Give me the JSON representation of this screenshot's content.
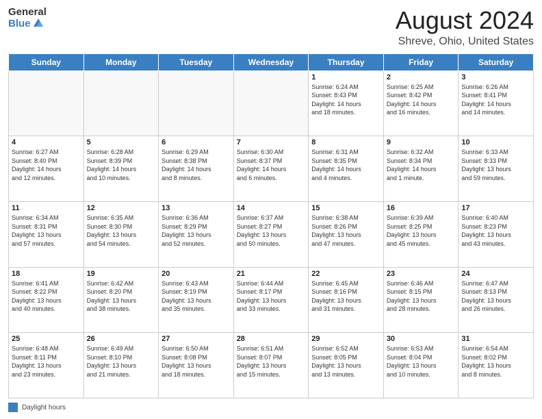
{
  "header": {
    "logo_general": "General",
    "logo_blue": "Blue",
    "month": "August 2024",
    "location": "Shreve, Ohio, United States"
  },
  "weekdays": [
    "Sunday",
    "Monday",
    "Tuesday",
    "Wednesday",
    "Thursday",
    "Friday",
    "Saturday"
  ],
  "legend_label": "Daylight hours",
  "weeks": [
    [
      {
        "num": "",
        "info": ""
      },
      {
        "num": "",
        "info": ""
      },
      {
        "num": "",
        "info": ""
      },
      {
        "num": "",
        "info": ""
      },
      {
        "num": "1",
        "info": "Sunrise: 6:24 AM\nSunset: 8:43 PM\nDaylight: 14 hours\nand 18 minutes."
      },
      {
        "num": "2",
        "info": "Sunrise: 6:25 AM\nSunset: 8:42 PM\nDaylight: 14 hours\nand 16 minutes."
      },
      {
        "num": "3",
        "info": "Sunrise: 6:26 AM\nSunset: 8:41 PM\nDaylight: 14 hours\nand 14 minutes."
      }
    ],
    [
      {
        "num": "4",
        "info": "Sunrise: 6:27 AM\nSunset: 8:40 PM\nDaylight: 14 hours\nand 12 minutes."
      },
      {
        "num": "5",
        "info": "Sunrise: 6:28 AM\nSunset: 8:39 PM\nDaylight: 14 hours\nand 10 minutes."
      },
      {
        "num": "6",
        "info": "Sunrise: 6:29 AM\nSunset: 8:38 PM\nDaylight: 14 hours\nand 8 minutes."
      },
      {
        "num": "7",
        "info": "Sunrise: 6:30 AM\nSunset: 8:37 PM\nDaylight: 14 hours\nand 6 minutes."
      },
      {
        "num": "8",
        "info": "Sunrise: 6:31 AM\nSunset: 8:35 PM\nDaylight: 14 hours\nand 4 minutes."
      },
      {
        "num": "9",
        "info": "Sunrise: 6:32 AM\nSunset: 8:34 PM\nDaylight: 14 hours\nand 1 minute."
      },
      {
        "num": "10",
        "info": "Sunrise: 6:33 AM\nSunset: 8:33 PM\nDaylight: 13 hours\nand 59 minutes."
      }
    ],
    [
      {
        "num": "11",
        "info": "Sunrise: 6:34 AM\nSunset: 8:31 PM\nDaylight: 13 hours\nand 57 minutes."
      },
      {
        "num": "12",
        "info": "Sunrise: 6:35 AM\nSunset: 8:30 PM\nDaylight: 13 hours\nand 54 minutes."
      },
      {
        "num": "13",
        "info": "Sunrise: 6:36 AM\nSunset: 8:29 PM\nDaylight: 13 hours\nand 52 minutes."
      },
      {
        "num": "14",
        "info": "Sunrise: 6:37 AM\nSunset: 8:27 PM\nDaylight: 13 hours\nand 50 minutes."
      },
      {
        "num": "15",
        "info": "Sunrise: 6:38 AM\nSunset: 8:26 PM\nDaylight: 13 hours\nand 47 minutes."
      },
      {
        "num": "16",
        "info": "Sunrise: 6:39 AM\nSunset: 8:25 PM\nDaylight: 13 hours\nand 45 minutes."
      },
      {
        "num": "17",
        "info": "Sunrise: 6:40 AM\nSunset: 8:23 PM\nDaylight: 13 hours\nand 43 minutes."
      }
    ],
    [
      {
        "num": "18",
        "info": "Sunrise: 6:41 AM\nSunset: 8:22 PM\nDaylight: 13 hours\nand 40 minutes."
      },
      {
        "num": "19",
        "info": "Sunrise: 6:42 AM\nSunset: 8:20 PM\nDaylight: 13 hours\nand 38 minutes."
      },
      {
        "num": "20",
        "info": "Sunrise: 6:43 AM\nSunset: 8:19 PM\nDaylight: 13 hours\nand 35 minutes."
      },
      {
        "num": "21",
        "info": "Sunrise: 6:44 AM\nSunset: 8:17 PM\nDaylight: 13 hours\nand 33 minutes."
      },
      {
        "num": "22",
        "info": "Sunrise: 6:45 AM\nSunset: 8:16 PM\nDaylight: 13 hours\nand 31 minutes."
      },
      {
        "num": "23",
        "info": "Sunrise: 6:46 AM\nSunset: 8:15 PM\nDaylight: 13 hours\nand 28 minutes."
      },
      {
        "num": "24",
        "info": "Sunrise: 6:47 AM\nSunset: 8:13 PM\nDaylight: 13 hours\nand 26 minutes."
      }
    ],
    [
      {
        "num": "25",
        "info": "Sunrise: 6:48 AM\nSunset: 8:11 PM\nDaylight: 13 hours\nand 23 minutes."
      },
      {
        "num": "26",
        "info": "Sunrise: 6:49 AM\nSunset: 8:10 PM\nDaylight: 13 hours\nand 21 minutes."
      },
      {
        "num": "27",
        "info": "Sunrise: 6:50 AM\nSunset: 8:08 PM\nDaylight: 13 hours\nand 18 minutes."
      },
      {
        "num": "28",
        "info": "Sunrise: 6:51 AM\nSunset: 8:07 PM\nDaylight: 13 hours\nand 15 minutes."
      },
      {
        "num": "29",
        "info": "Sunrise: 6:52 AM\nSunset: 8:05 PM\nDaylight: 13 hours\nand 13 minutes."
      },
      {
        "num": "30",
        "info": "Sunrise: 6:53 AM\nSunset: 8:04 PM\nDaylight: 13 hours\nand 10 minutes."
      },
      {
        "num": "31",
        "info": "Sunrise: 6:54 AM\nSunset: 8:02 PM\nDaylight: 13 hours\nand 8 minutes."
      }
    ]
  ]
}
